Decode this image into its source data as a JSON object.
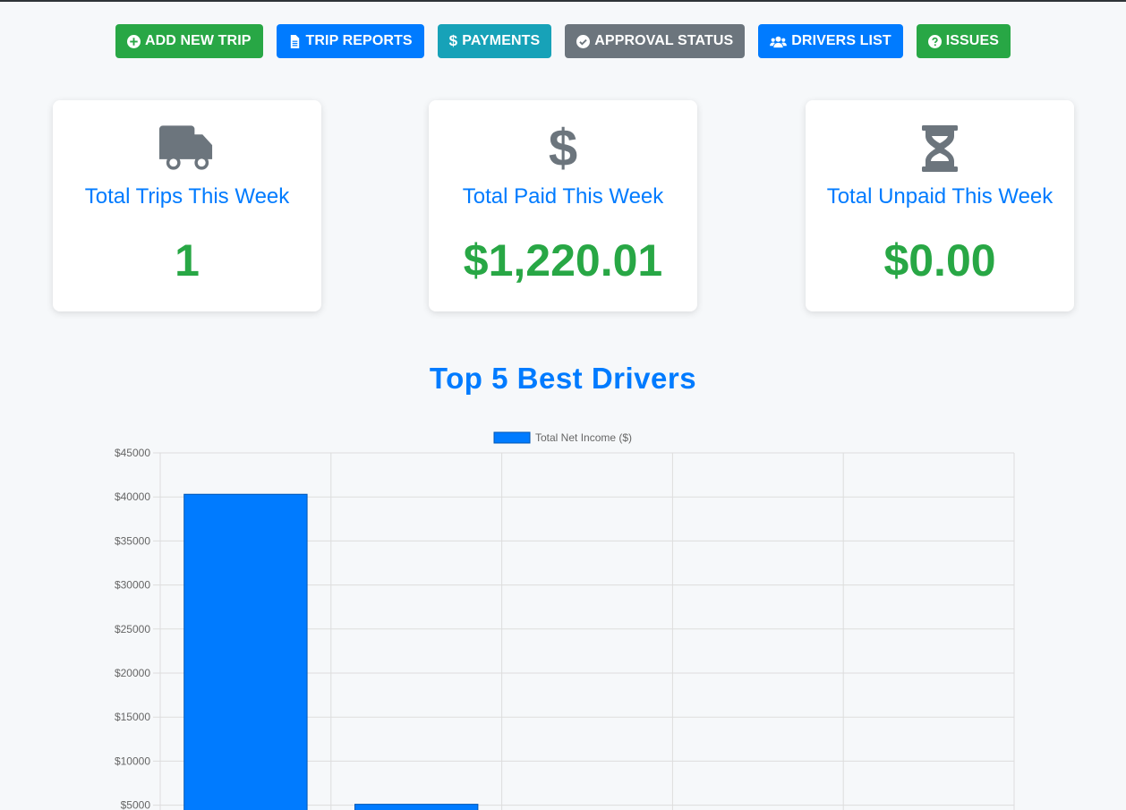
{
  "toolbar": {
    "buttons": [
      {
        "label": "ADD NEW TRIP",
        "icon": "plus-circle-icon",
        "color": "#28a745"
      },
      {
        "label": "TRIP REPORTS",
        "icon": "file-icon",
        "color": "#007bff"
      },
      {
        "label": "PAYMENTS",
        "icon": "dollar-icon",
        "color": "#17a2b8"
      },
      {
        "label": "APPROVAL STATUS",
        "icon": "check-circle-icon",
        "color": "#6c757d"
      },
      {
        "label": "DRIVERS LIST",
        "icon": "users-icon",
        "color": "#007bff"
      },
      {
        "label": "ISSUES",
        "icon": "question-circle-icon",
        "color": "#28a745"
      }
    ]
  },
  "stats": [
    {
      "label": "Total Trips This Week",
      "value": "1",
      "icon": "truck-icon"
    },
    {
      "label": "Total Paid This Week",
      "value": "$1,220.01",
      "icon": "dollar-icon"
    },
    {
      "label": "Total Unpaid This Week",
      "value": "$0.00",
      "icon": "hourglass-icon"
    }
  ],
  "section_title": "Top 5 Best Drivers",
  "chart_data": {
    "type": "bar",
    "categories": [
      "",
      "",
      "",
      "",
      ""
    ],
    "series": [
      {
        "name": "Total Net Income ($)",
        "values": [
          40300,
          5100,
          0,
          0,
          0
        ],
        "color": "#007bff"
      }
    ],
    "ylim": [
      0,
      45000
    ],
    "yticks": [
      "$45000",
      "$40000",
      "$35000",
      "$30000",
      "$25000",
      "$20000",
      "$15000",
      "$10000",
      "$5000"
    ],
    "ytick_values": [
      45000,
      40000,
      35000,
      30000,
      25000,
      20000,
      15000,
      10000,
      5000
    ],
    "legend": "top-center",
    "grid": true
  }
}
